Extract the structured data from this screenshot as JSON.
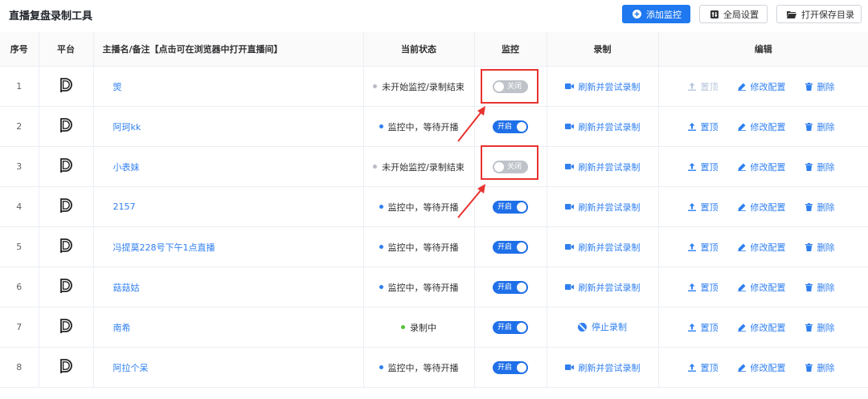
{
  "app": {
    "title": "直播复盘录制工具"
  },
  "toolbar": {
    "add_label": "添加监控",
    "settings_label": "全局设置",
    "folder_label": "打开保存目录"
  },
  "table": {
    "headers": {
      "index": "序号",
      "platform": "平台",
      "name": "主播名/备注【点击可在浏览器中打开直播间】",
      "status": "当前状态",
      "monitor": "监控",
      "record": "录制",
      "edit": "编辑"
    },
    "rows": [
      {
        "index": "1",
        "name": "煚",
        "status": "未开始监控/录制结束",
        "monitor": "关闭",
        "record": "刷新并尝试录制",
        "pin": "置顶",
        "modify": "修改配置",
        "delete": "删除"
      },
      {
        "index": "2",
        "name": "阿珂kk",
        "status": "监控中，等待开播",
        "monitor": "开启",
        "record": "刷新并尝试录制",
        "pin": "置顶",
        "modify": "修改配置",
        "delete": "删除"
      },
      {
        "index": "3",
        "name": "小表妹",
        "status": "未开始监控/录制结束",
        "monitor": "关闭",
        "record": "刷新并尝试录制",
        "pin": "置顶",
        "modify": "修改配置",
        "delete": "删除"
      },
      {
        "index": "4",
        "name": "2157",
        "status": "监控中，等待开播",
        "monitor": "开启",
        "record": "刷新并尝试录制",
        "pin": "置顶",
        "modify": "修改配置",
        "delete": "删除"
      },
      {
        "index": "5",
        "name": "冯提莫228号下午1点直播",
        "status": "监控中，等待开播",
        "monitor": "开启",
        "record": "刷新并尝试录制",
        "pin": "置顶",
        "modify": "修改配置",
        "delete": "删除"
      },
      {
        "index": "6",
        "name": "菇菇姑",
        "status": "监控中，等待开播",
        "monitor": "开启",
        "record": "刷新并尝试录制",
        "pin": "置顶",
        "modify": "修改配置",
        "delete": "删除"
      },
      {
        "index": "7",
        "name": "南希",
        "status": "录制中",
        "monitor": "开启",
        "record": "停止录制",
        "pin": "置顶",
        "modify": "修改配置",
        "delete": "删除"
      },
      {
        "index": "8",
        "name": "阿拉个呆",
        "status": "监控中，等待开播",
        "monitor": "开启",
        "record": "刷新并尝试录制",
        "pin": "置顶",
        "modify": "修改配置",
        "delete": "删除"
      }
    ]
  },
  "icons": {
    "add": "plus-circle-icon",
    "settings": "settings-icon",
    "folder": "folder-open-icon",
    "platform": "douyin-platform-icon",
    "record": "video-camera-icon",
    "stop": "stop-icon",
    "pin": "pin-top-icon",
    "modify": "edit-pen-icon",
    "delete": "trash-icon"
  },
  "colors": {
    "primary": "#1f78f0",
    "link": "#2f7ff0",
    "switch_on": "#1f6fe8",
    "switch_off": "#bfc3c9",
    "status_idle": "#b9bcc2",
    "status_monitoring": "#2f7ff0",
    "status_recording": "#56c13a",
    "annotation": "#e8332f"
  }
}
